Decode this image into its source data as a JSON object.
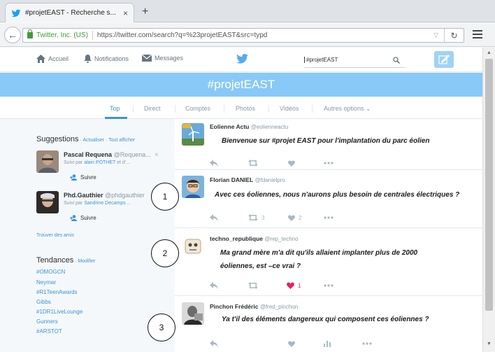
{
  "browser": {
    "tab_title": "#projetEAST - Recherche s...",
    "tab_close": "×",
    "new_tab": "+",
    "url_org": "Twitter, Inc. (US)",
    "url": "https://twitter.com/search?q=%23projetEAST&src=typd"
  },
  "nav": {
    "home": "Accueil",
    "notifications": "Notifications",
    "messages": "Messages",
    "search_value": "#projetEAST"
  },
  "banner": {
    "title": "#projetEAST"
  },
  "tabs": [
    "Top",
    "Direct",
    "Comptes",
    "Photos",
    "Vidéos",
    "Autres options ⌄"
  ],
  "sidebar": {
    "suggestions_title": "Suggestions",
    "suggestions_dot": " · ",
    "refresh": "Actualiser",
    "show_all": "Tout afficher",
    "suggestions": [
      {
        "name": "Pascal Requena",
        "handle": "@Requena...",
        "followed_prefix": "Suivi par ",
        "followed_by": "alain POTHET",
        "followed_suffix": " et d'...",
        "follow_label": "Suivre"
      },
      {
        "name": "Phd.Gauthier",
        "handle": "@phdgauthier",
        "followed_prefix": "Suivi par ",
        "followed_by": "Sandrine Decamps",
        "followed_suffix": " ...",
        "follow_label": "Suivre"
      }
    ],
    "find_friends": "Trouver des amis",
    "trends_title": "Tendances",
    "trends_modify": "Modifier",
    "trends": [
      "#OMOGCN",
      "Neymar",
      "#R1TeenAwards",
      "Gibbs",
      "#1DR1LiveLounge",
      "Gunners",
      "#ARSTOT"
    ]
  },
  "tweets": [
    {
      "name": "Eolienne Actu",
      "handle": "@eolienneactu",
      "text": "Bienvenue sur #projet EAST  pour l'implantation du parc éolien",
      "retweets": "",
      "likes": ""
    },
    {
      "name": "Florian DANIEL",
      "handle": "@fdanielpro",
      "text": "Avec ces éoliennes, nous n'aurons plus besoin de centrales électriques ?",
      "retweets": "3",
      "likes": "2"
    },
    {
      "name": "techno_republique",
      "handle": "@rep_techno",
      "text_line1": "Ma grand mère m'a dit qu'ils allaient implanter plus de 2000",
      "text_line2": "éoliennes, est –ce vrai ?",
      "retweets": "",
      "likes": "1"
    },
    {
      "name": "Pinchon Frédéric",
      "handle": "@fred_pinchon",
      "text": "Ya t'il des éléments dangereux qui composent ces éoliennes ?"
    }
  ],
  "annotations": [
    "1",
    "2",
    "3"
  ],
  "colors": {
    "accent": "#3b94d9",
    "banner": "#88c9f7",
    "like_red": "#e0245e"
  }
}
